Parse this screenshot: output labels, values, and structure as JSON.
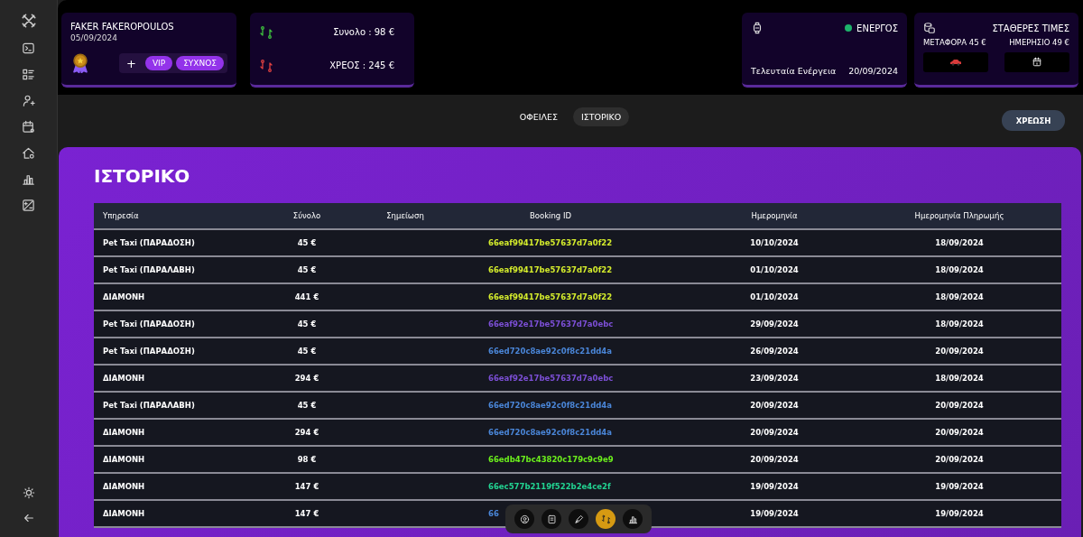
{
  "customer": {
    "name": "FAKER FAKEROPOULOS",
    "date": "05/09/2024",
    "add": "+",
    "tags": [
      "VIP",
      "ΣΥΧΝΟΣ"
    ]
  },
  "balance": {
    "total": "Συνολο : 98 €",
    "debt": "ΧΡΕΟΣ : 245 €"
  },
  "status": {
    "state": "ΕΝΕΡΓΟΣ",
    "color": "#1db36b",
    "last_label": "Τελευταία Ενέργεια",
    "last_date": "20/09/2024"
  },
  "prices": {
    "title": "ΣΤΑΘΕΡΕΣ ΤΙΜΕΣ",
    "transport": "ΜΕΤΑΦΟΡΑ 45 €",
    "daily": "ΗΜΕΡΗΣΙΟ 49 €"
  },
  "tabs": [
    {
      "label": "ΟΦΕΙΛΕΣ",
      "selected": false
    },
    {
      "label": "ΙΣΤΟΡΙΚΟ",
      "selected": true
    }
  ],
  "charge_button": "ΧΡΕΩΣΗ",
  "panel_title": "ΙΣΤΟΡΙΚΟ",
  "table": {
    "columns": [
      "Υπηρεσία",
      "Σύνολο",
      "Σημείωση",
      "Booking ID",
      "Ημερομηνία",
      "Ημερομηνία Πληρωμής"
    ],
    "rows": [
      {
        "service": "Pet Taxi (ΠΑΡΑΔΟΣΗ)",
        "total": "45 €",
        "booking_id": "66eaf99417be57637d7a0f22",
        "color": "#d4ec2c",
        "date": "10/10/2024",
        "paid": "18/09/2024"
      },
      {
        "service": "Pet Taxi (ΠΑΡΑΛΑΒΗ)",
        "total": "45 €",
        "booking_id": "66eaf99417be57637d7a0f22",
        "color": "#d4ec2c",
        "date": "01/10/2024",
        "paid": "18/09/2024"
      },
      {
        "service": "ΔΙΑΜΟΝΗ",
        "total": "441 €",
        "booking_id": "66eaf99417be57637d7a0f22",
        "color": "#d4ec2c",
        "date": "01/10/2024",
        "paid": "18/09/2024"
      },
      {
        "service": "Pet Taxi (ΠΑΡΑΔΟΣΗ)",
        "total": "45 €",
        "booking_id": "66eaf92e17be57637d7a0ebc",
        "color": "#7c4fd6",
        "date": "29/09/2024",
        "paid": "18/09/2024"
      },
      {
        "service": "Pet Taxi (ΠΑΡΑΔΟΣΗ)",
        "total": "45 €",
        "booking_id": "66ed720c8ae92c0f8c21dd4a",
        "color": "#4a86d8",
        "date": "26/09/2024",
        "paid": "20/09/2024"
      },
      {
        "service": "ΔΙΑΜΟΝΗ",
        "total": "294 €",
        "booking_id": "66eaf92e17be57637d7a0ebc",
        "color": "#7c4fd6",
        "date": "23/09/2024",
        "paid": "18/09/2024"
      },
      {
        "service": "Pet Taxi (ΠΑΡΑΛΑΒΗ)",
        "total": "45 €",
        "booking_id": "66ed720c8ae92c0f8c21dd4a",
        "color": "#4a86d8",
        "date": "20/09/2024",
        "paid": "20/09/2024"
      },
      {
        "service": "ΔΙΑΜΟΝΗ",
        "total": "294 €",
        "booking_id": "66ed720c8ae92c0f8c21dd4a",
        "color": "#4a86d8",
        "date": "20/09/2024",
        "paid": "20/09/2024"
      },
      {
        "service": "ΔΙΑΜΟΝΗ",
        "total": "98 €",
        "booking_id": "66edb47bc43820c179c9c9e9",
        "color": "#6cf01c",
        "date": "20/09/2024",
        "paid": "20/09/2024"
      },
      {
        "service": "ΔΙΑΜΟΝΗ",
        "total": "147 €",
        "booking_id": "66ec577b2119f522b2e4ce2f",
        "color": "#22d492",
        "date": "19/09/2024",
        "paid": "19/09/2024"
      },
      {
        "service": "ΔΙΑΜΟΝΗ",
        "total": "147 €",
        "booking_id": "66",
        "color": "#4a86d8",
        "date": "19/09/2024",
        "paid": "19/09/2024"
      }
    ]
  },
  "dock": [
    {
      "selected": false
    },
    {
      "selected": false
    },
    {
      "selected": false
    },
    {
      "selected": true
    },
    {
      "selected": false
    }
  ]
}
